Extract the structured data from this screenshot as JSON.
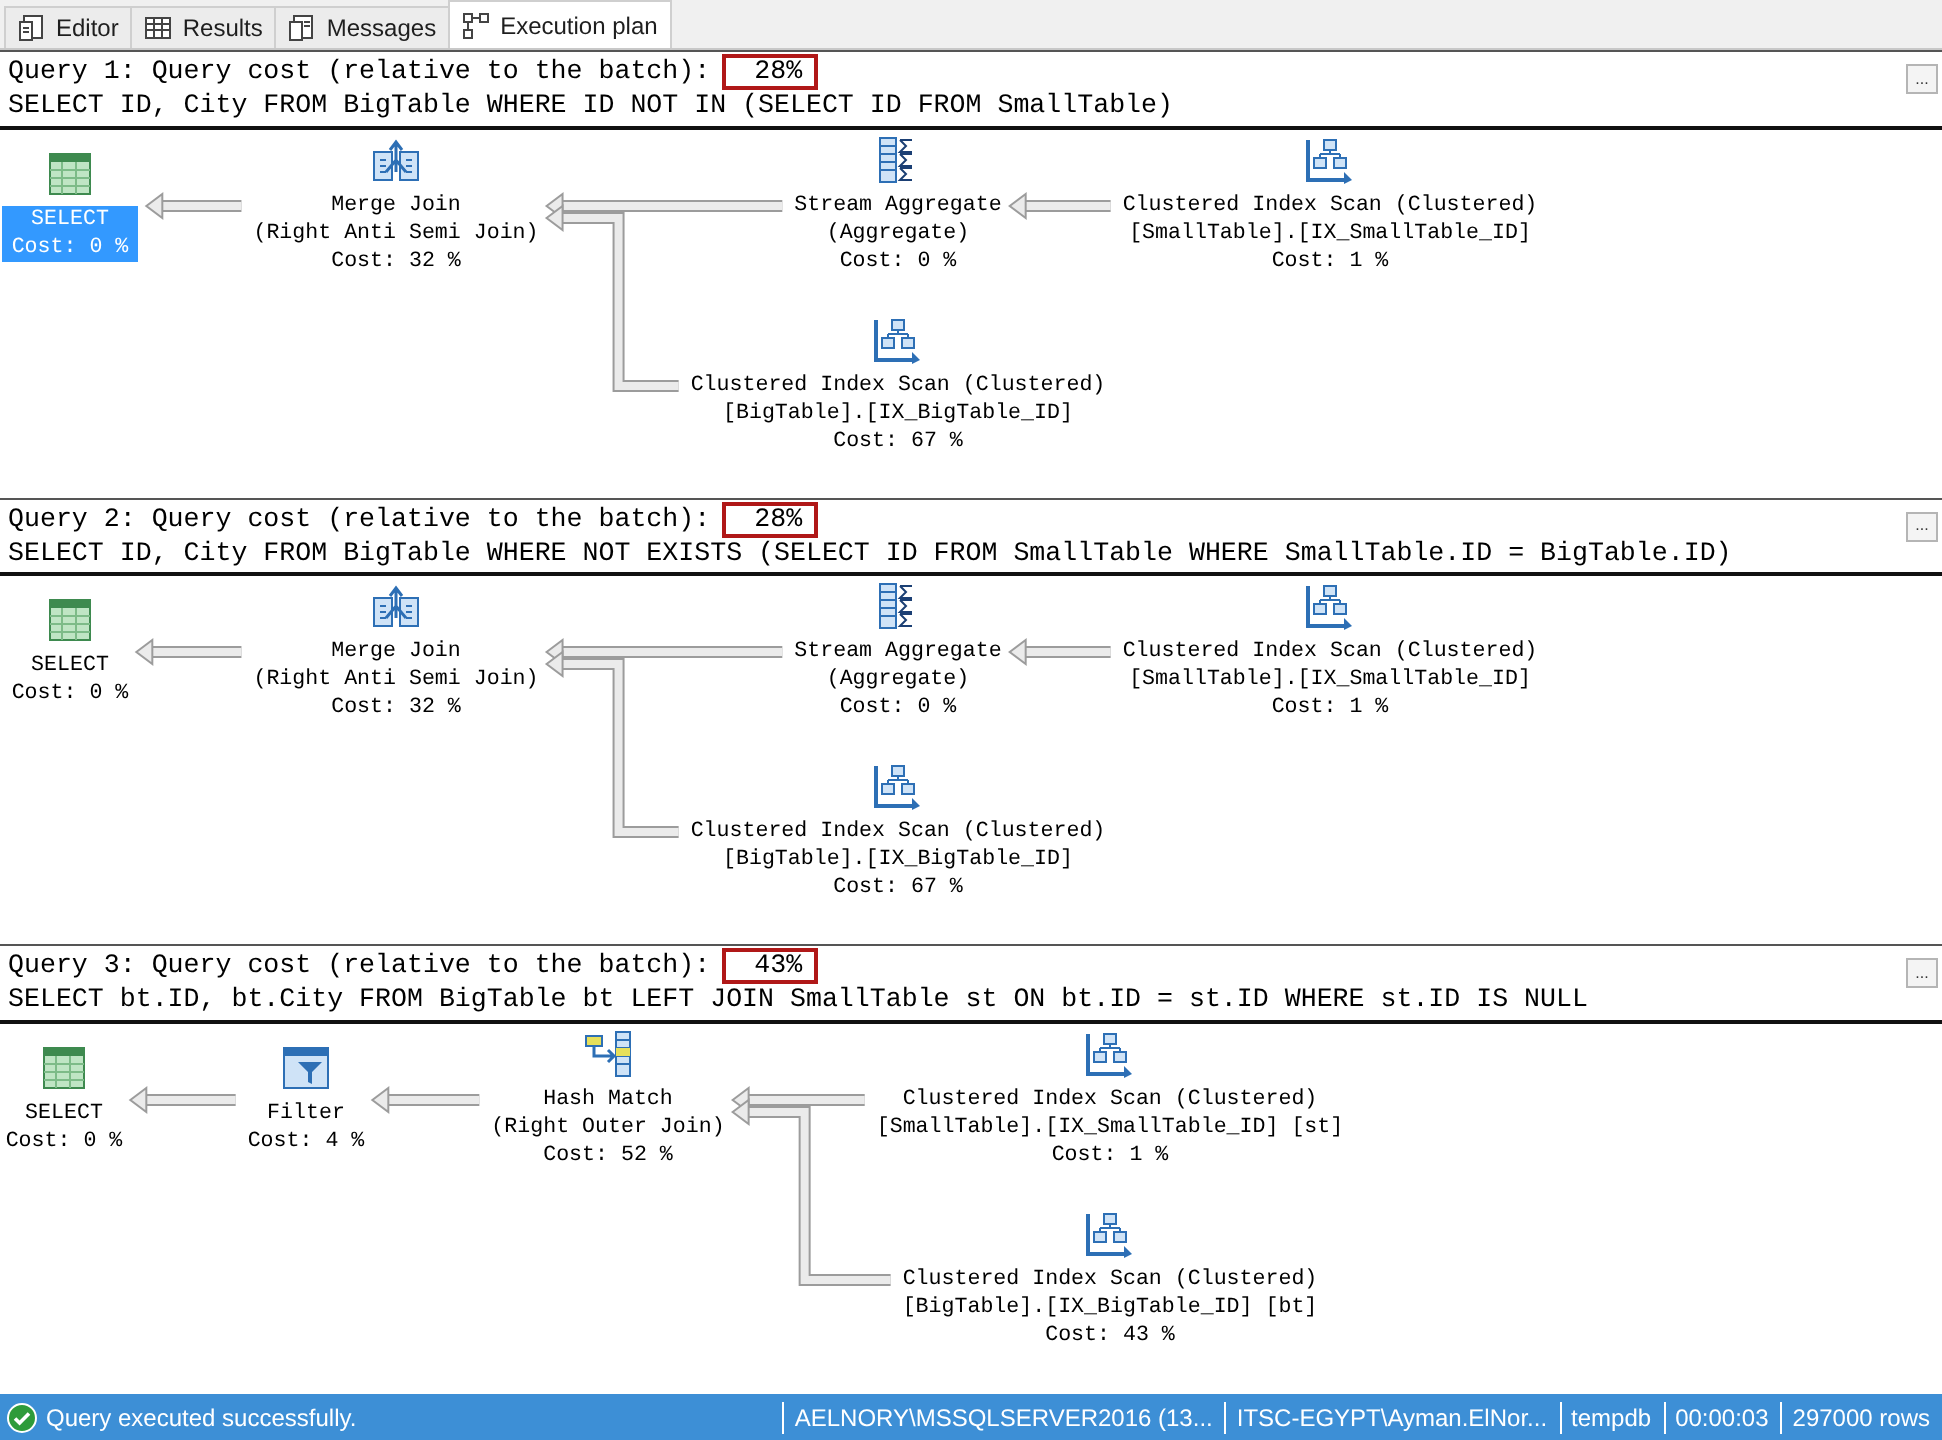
{
  "tabs": [
    {
      "label": "Editor",
      "kind": "editor",
      "selected": false
    },
    {
      "label": "Results",
      "kind": "results",
      "selected": false
    },
    {
      "label": "Messages",
      "kind": "messages",
      "selected": false
    },
    {
      "label": "Execution plan",
      "kind": "plan",
      "selected": true
    }
  ],
  "queries": [
    {
      "title": "Query 1: Query cost (relative to the batch):",
      "cost": "28%",
      "sql": "SELECT ID, City FROM BigTable WHERE ID NOT IN (SELECT ID FROM SmallTable)",
      "details_button": "...",
      "plan": {
        "kind": "select",
        "selected": true,
        "lines": [
          "SELECT",
          "Cost: 0 %"
        ],
        "children": [
          {
            "kind": "merge_join",
            "selected": false,
            "lines": [
              "Merge Join",
              "(Right Anti Semi Join)",
              "Cost: 32 %"
            ],
            "children": [
              {
                "kind": "stream_aggregate",
                "selected": false,
                "lines": [
                  "Stream Aggregate",
                  "(Aggregate)",
                  "Cost: 0 %"
                ],
                "children": [
                  {
                    "kind": "clustered_index_scan",
                    "selected": false,
                    "lines": [
                      "Clustered Index Scan (Clustered)",
                      "[SmallTable].[IX_SmallTable_ID]",
                      "Cost: 1 %"
                    ]
                  }
                ]
              },
              {
                "kind": "clustered_index_scan",
                "selected": false,
                "lines": [
                  "Clustered Index Scan (Clustered)",
                  "[BigTable].[IX_BigTable_ID]",
                  "Cost: 67 %"
                ]
              }
            ]
          }
        ]
      }
    },
    {
      "title": "Query 2: Query cost (relative to the batch):",
      "cost": "28%",
      "sql": "SELECT ID, City FROM BigTable WHERE NOT EXISTS (SELECT ID FROM SmallTable WHERE SmallTable.ID = BigTable.ID)",
      "details_button": "...",
      "plan": {
        "kind": "select",
        "selected": false,
        "lines": [
          "SELECT",
          "Cost: 0 %"
        ],
        "children": [
          {
            "kind": "merge_join",
            "selected": false,
            "lines": [
              "Merge Join",
              "(Right Anti Semi Join)",
              "Cost: 32 %"
            ],
            "children": [
              {
                "kind": "stream_aggregate",
                "selected": false,
                "lines": [
                  "Stream Aggregate",
                  "(Aggregate)",
                  "Cost: 0 %"
                ],
                "children": [
                  {
                    "kind": "clustered_index_scan",
                    "selected": false,
                    "lines": [
                      "Clustered Index Scan (Clustered)",
                      "[SmallTable].[IX_SmallTable_ID]",
                      "Cost: 1 %"
                    ]
                  }
                ]
              },
              {
                "kind": "clustered_index_scan",
                "selected": false,
                "lines": [
                  "Clustered Index Scan (Clustered)",
                  "[BigTable].[IX_BigTable_ID]",
                  "Cost: 67 %"
                ]
              }
            ]
          }
        ]
      }
    },
    {
      "title": "Query 3: Query cost (relative to the batch):",
      "cost": "43%",
      "sql": "SELECT bt.ID, bt.City FROM BigTable bt LEFT JOIN SmallTable st ON bt.ID = st.ID WHERE st.ID IS NULL",
      "details_button": "...",
      "plan": {
        "kind": "select",
        "selected": false,
        "lines": [
          "SELECT",
          "Cost: 0 %"
        ],
        "children": [
          {
            "kind": "filter",
            "selected": false,
            "lines": [
              "Filter",
              "Cost: 4 %"
            ],
            "children": [
              {
                "kind": "hash_match",
                "selected": false,
                "lines": [
                  "Hash Match",
                  "(Right Outer Join)",
                  "Cost: 52 %"
                ],
                "children": [
                  {
                    "kind": "clustered_index_scan",
                    "selected": false,
                    "lines": [
                      "Clustered Index Scan (Clustered)",
                      "[SmallTable].[IX_SmallTable_ID] [st]",
                      "Cost: 1 %"
                    ]
                  },
                  {
                    "kind": "clustered_index_scan",
                    "selected": false,
                    "lines": [
                      "Clustered Index Scan (Clustered)",
                      "[BigTable].[IX_BigTable_ID] [bt]",
                      "Cost: 43 %"
                    ]
                  }
                ]
              }
            ]
          }
        ]
      }
    }
  ],
  "status_bar": {
    "message": "Query executed successfully.",
    "segments": [
      "AELNORY\\MSSQLSERVER2016 (13...",
      "ITSC-EGYPT\\Ayman.ElNor...",
      "tempdb",
      "00:00:03",
      "297000 rows"
    ]
  }
}
